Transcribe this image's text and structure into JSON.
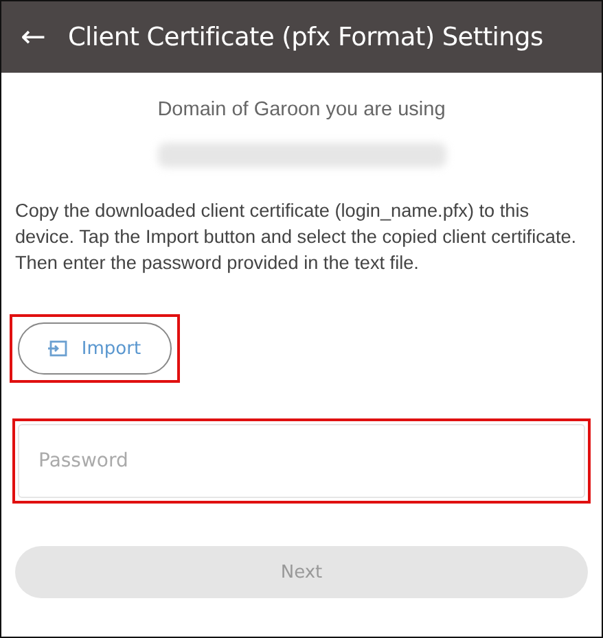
{
  "header": {
    "back_icon": "←",
    "title": "Client Certificate (pfx Format) Settings"
  },
  "domain": {
    "label": "Domain of Garoon you are using",
    "value_redacted": true
  },
  "instructions": "Copy the downloaded client certificate (login_name.pfx) to this device. Tap the Import button and select the copied client certificate. Then enter the password provided in the text file.",
  "import_button": {
    "label": "Import",
    "highlighted": true
  },
  "password": {
    "placeholder": "Password",
    "highlighted": true
  },
  "next_button": {
    "label": "Next",
    "disabled": true
  }
}
